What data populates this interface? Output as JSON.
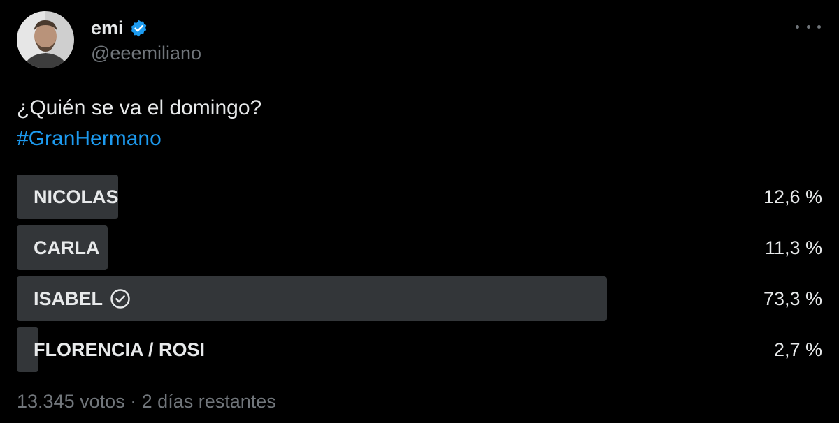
{
  "author": {
    "display_name": "emi",
    "handle": "@eeemiliano",
    "verified": true,
    "avatar": "profile-photo"
  },
  "tweet": {
    "text": "¿Quién se va el domingo?",
    "hashtag": "#GranHermano"
  },
  "poll": {
    "options": [
      {
        "label": "NICOLAS",
        "percent_text": "12,6 %",
        "percent": 12.6,
        "winner": false
      },
      {
        "label": "CARLA",
        "percent_text": "11,3 %",
        "percent": 11.3,
        "winner": false
      },
      {
        "label": "ISABEL",
        "percent_text": "73,3 %",
        "percent": 73.3,
        "winner": true
      },
      {
        "label": "FLORENCIA / ROSI",
        "percent_text": "2,7 %",
        "percent": 2.7,
        "winner": false
      }
    ],
    "votes": "13.345 votos",
    "separator": "·",
    "time_left": "2 días restantes"
  },
  "icons": {
    "verified": "verified-badge-icon",
    "more": "more-options-icon",
    "winner": "check-circle-icon"
  },
  "colors": {
    "background": "#000000",
    "text": "#e7e9ea",
    "muted": "#71767b",
    "accent": "#1d9bf0",
    "bar": "#333639"
  }
}
